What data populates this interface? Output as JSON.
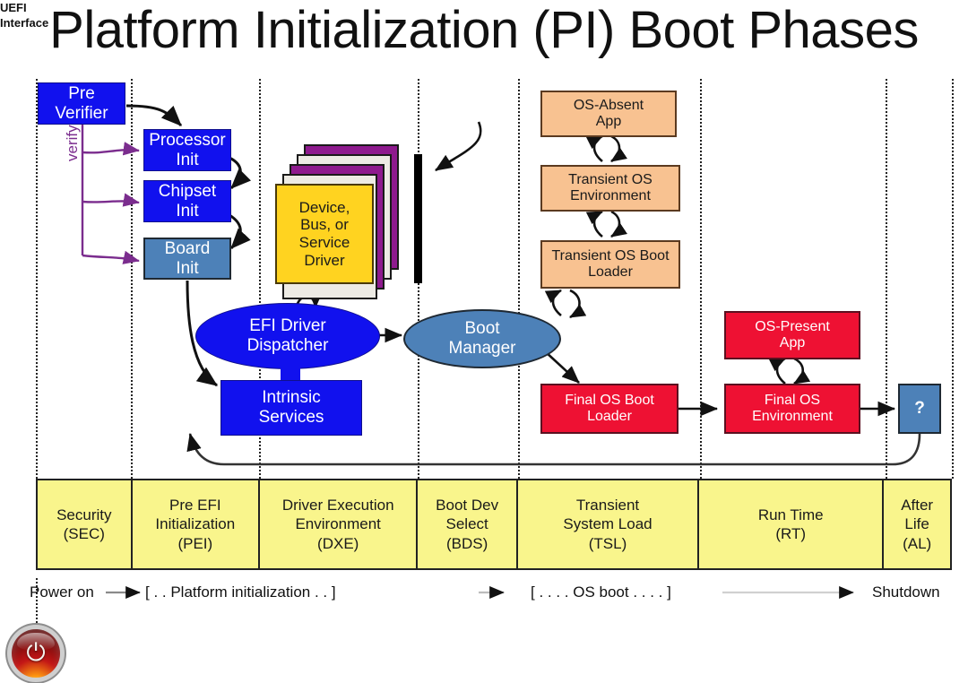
{
  "title": "Platform Initialization (PI) Boot Phases",
  "annotations": {
    "uefi_interface": "UEFI\nInterface",
    "verify": "verify"
  },
  "nodes": {
    "pre_verifier": "Pre\nVerifier",
    "processor_init": "Processor\nInit",
    "chipset_init": "Chipset\nInit",
    "board_init": "Board\nInit",
    "driver_card": "Device,\nBus, or\nService\nDriver",
    "efi_driver_dispatcher": "EFI Driver\nDispatcher",
    "intrinsic_services": "Intrinsic\nServices",
    "boot_manager": "Boot\nManager",
    "os_absent_app": "OS-Absent\nApp",
    "transient_os_environment": "Transient OS\nEnvironment",
    "transient_os_boot_loader": "Transient OS Boot\nLoader",
    "final_os_boot_loader": "Final OS Boot\nLoader",
    "os_present_app": "OS-Present\nApp",
    "final_os_environment": "Final OS\nEnvironment",
    "after_life_unknown": "?"
  },
  "phases": [
    {
      "name": "Security\n(SEC)"
    },
    {
      "name": "Pre EFI\nInitialization\n(PEI)"
    },
    {
      "name": "Driver Execution\nEnvironment\n(DXE)"
    },
    {
      "name": "Boot Dev\nSelect\n(BDS)"
    },
    {
      "name": "Transient\nSystem Load\n(TSL)"
    },
    {
      "name": "Run Time\n(RT)"
    },
    {
      "name": "After\nLife\n(AL)"
    }
  ],
  "timeline": {
    "power_on": "Power on",
    "platform_init": "[ . . Platform initialization . . ]",
    "os_boot": "[ . . . . OS boot . . . . ]",
    "shutdown": "Shutdown"
  },
  "icons": {
    "power_button": "power-button-icon",
    "power_glyph": "⏻"
  },
  "colors": {
    "blue": "#1111EE",
    "steel_blue": "#4D81B8",
    "peach": "#F8C291",
    "red": "#EE1133",
    "yellow_card": "#FFD320",
    "phase_yellow": "#F9F58C",
    "purple_card": "#8E1A8E",
    "verify_arrow": "#7B2D8E"
  }
}
